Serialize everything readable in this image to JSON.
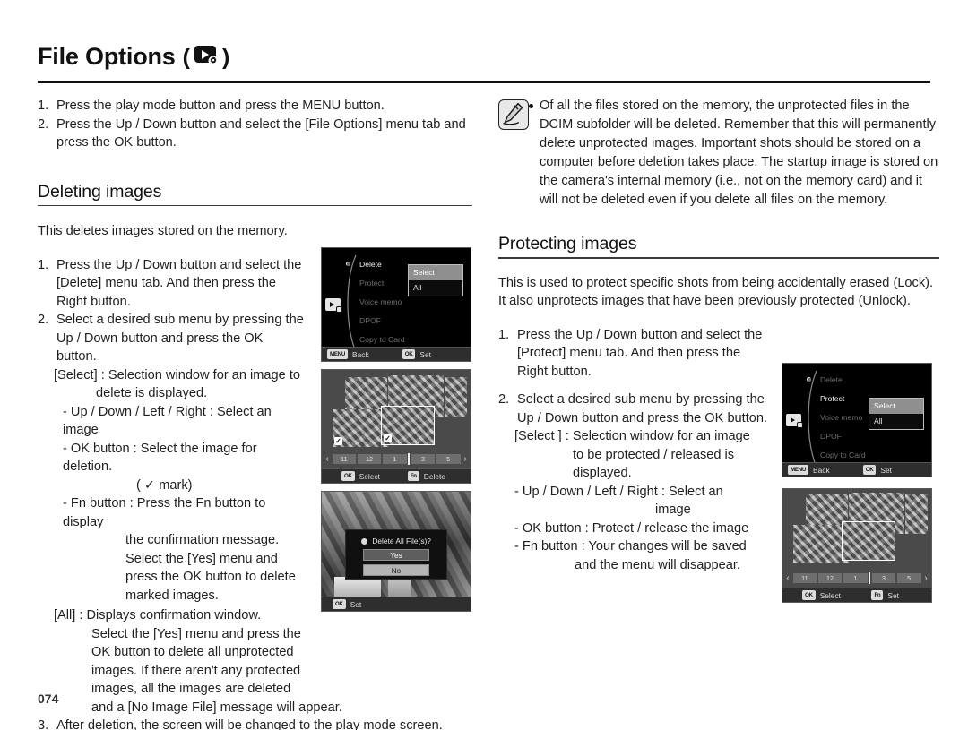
{
  "header": {
    "title": "File Options",
    "paren_open": "(",
    "paren_close": ")",
    "icon": "playback-gear-icon"
  },
  "page_number": "074",
  "intro_steps": [
    {
      "num": "1.",
      "text": "Press the play mode button and press the MENU button."
    },
    {
      "num": "2.",
      "text": "Press the Up / Down button and select the [File Options] menu tab and press the OK button."
    }
  ],
  "note": {
    "icon": "pencil-note-icon",
    "bullet": "•",
    "text": "Of all the files stored on the memory, the unprotected files in the DCIM subfolder will be deleted. Remember that this will permanently delete unprotected images. Important shots should be stored on a computer before deletion takes place. The startup image is stored on the camera's internal memory (i.e., not on the memory card) and it will not be deleted even if you delete all files on the memory."
  },
  "deleting": {
    "heading": "Deleting images",
    "lead": "This deletes images stored on the memory.",
    "step1_num": "1.",
    "step1_text": "Press the Up / Down button and select the [Delete] menu tab. And then press the Right button.",
    "step2_num": "2.",
    "step2_text": "Select a desired sub menu by pressing the Up / Down button and press the OK button.",
    "select_label": "[Select] : Selection window for an image to",
    "select_cont": "delete is displayed.",
    "bullet_updown": "- Up / Down / Left / Right : Select an image",
    "bullet_ok": "- OK button : Select the image for deletion.",
    "bullet_mark": "( ✓ mark)",
    "bullet_fn": "- Fn button : Press the Fn button to display",
    "fn_l2": "the confirmation message.",
    "fn_l3": "Select the [Yes] menu and",
    "fn_l4": "press the OK button to delete",
    "fn_l5": "marked images.",
    "all_label": "[All] : Displays confirmation window.",
    "all_l2": "Select the [Yes] menu and press the",
    "all_l3": "OK button to delete all unprotected",
    "all_l4": "images. If there aren't any protected",
    "all_l5": "images, all the images are deleted",
    "all_l6": "and a [No Image File] message will appear.",
    "step3_num": "3.",
    "step3_text": "After deletion, the screen will be changed to the play mode screen."
  },
  "protecting": {
    "heading": "Protecting images",
    "lead": "This is used to protect specific shots from being accidentally erased (Lock). It also unprotects images that have been previously protected (Unlock).",
    "step1_num": "1.",
    "step1_text": "Press the Up / Down button and select the [Protect] menu tab. And then press the Right button.",
    "step2_num": "2.",
    "step2_text": "Select a desired sub menu by pressing the Up / Down button and press the OK button.",
    "select_label": "[Select ] : Selection window for an image",
    "select_l2": "to be protected / released is",
    "select_l3": "displayed.",
    "bullet_updown": "- Up / Down / Left / Right : Select an",
    "bullet_updown_l2": "image",
    "bullet_ok": "- OK button : Protect / release the image",
    "bullet_fn": "- Fn button : Your changes will be saved",
    "bullet_fn_l2": "and the menu will disappear."
  },
  "lcd_delete_menu": {
    "items": [
      {
        "label": "Delete",
        "active": true
      },
      {
        "label": "Protect",
        "active": false
      },
      {
        "label": "Voice memo",
        "active": false
      },
      {
        "label": "DPOF",
        "active": false
      },
      {
        "label": "Copy to Card",
        "active": false
      }
    ],
    "submenu": [
      {
        "label": "Select",
        "selected": true
      },
      {
        "label": "All",
        "selected": false
      }
    ],
    "bottom": [
      {
        "key": "MENU",
        "label": "Back"
      },
      {
        "key": "OK",
        "label": "Set"
      }
    ]
  },
  "lcd_protect_menu": {
    "items": [
      {
        "label": "Delete",
        "active": false
      },
      {
        "label": "Protect",
        "active": true
      },
      {
        "label": "Voice memo",
        "active": false
      },
      {
        "label": "DPOF",
        "active": false
      },
      {
        "label": "Copy to Card",
        "active": false
      }
    ],
    "submenu": [
      {
        "label": "Select",
        "selected": true
      },
      {
        "label": "All",
        "selected": false
      }
    ],
    "bottom": [
      {
        "key": "MENU",
        "label": "Back"
      },
      {
        "key": "OK",
        "label": "Set"
      }
    ]
  },
  "lcd_thumb_delete": {
    "filmstrip": [
      "11",
      "12",
      "1",
      "3",
      "5"
    ],
    "arrow_left": "‹",
    "arrow_right": "›",
    "bottom": [
      {
        "key": "OK",
        "label": "Select"
      },
      {
        "key": "Fn",
        "label": "Delete"
      }
    ],
    "check": "✓"
  },
  "lcd_thumb_protect": {
    "filmstrip": [
      "11",
      "12",
      "1",
      "3",
      "5"
    ],
    "arrow_left": "‹",
    "arrow_right": "›",
    "bottom": [
      {
        "key": "OK",
        "label": "Select"
      },
      {
        "key": "Fn",
        "label": "Set"
      }
    ]
  },
  "lcd_delete_all": {
    "dialog_title": "Delete All File(s)?",
    "buttons": [
      {
        "label": "Yes",
        "selected": false
      },
      {
        "label": "No",
        "selected": true
      }
    ],
    "bottom": [
      {
        "key": "OK",
        "label": "Set"
      }
    ]
  },
  "colors": {
    "ink": "#1f1f1f",
    "rule": "#111111",
    "lcd_bg": "#000000",
    "lcd_highlight": "#8f8f8f"
  }
}
